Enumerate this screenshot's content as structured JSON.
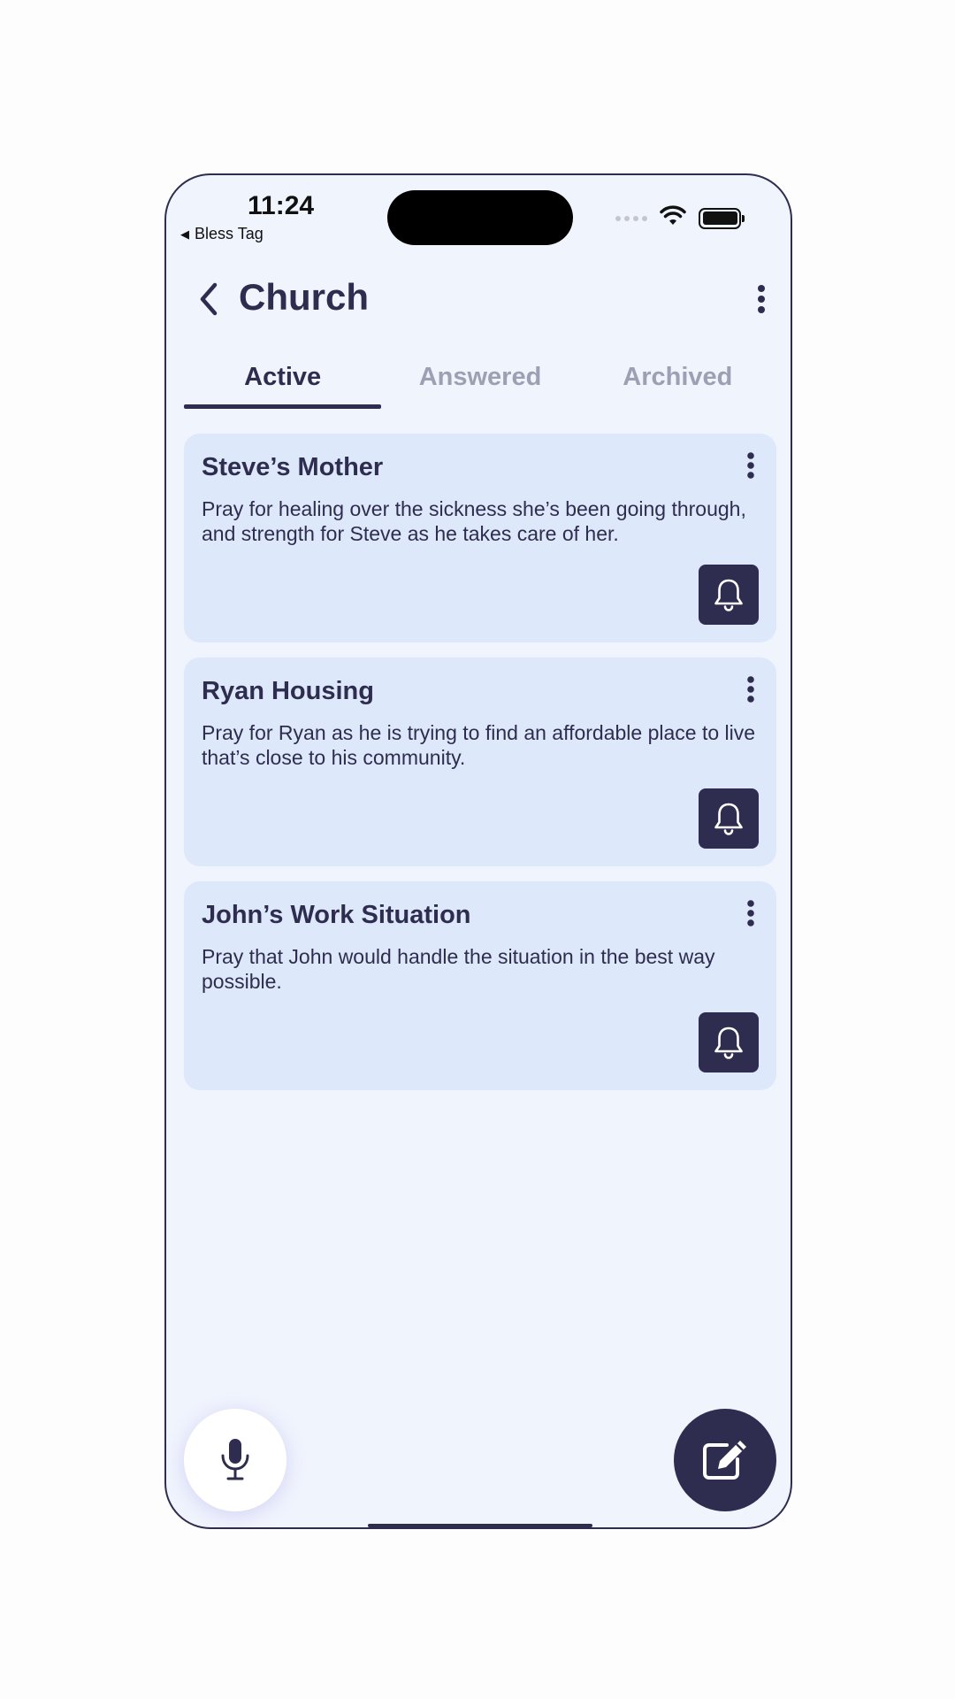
{
  "status_bar": {
    "time": "11:24",
    "back_app": "Bless Tag",
    "back_glyph": "◀"
  },
  "header": {
    "title": "Church"
  },
  "tabs": [
    {
      "label": "Active",
      "active": true
    },
    {
      "label": "Answered",
      "active": false
    },
    {
      "label": "Archived",
      "active": false
    }
  ],
  "prayers": [
    {
      "title": "Steve’s Mother",
      "text": "Pray for healing over the sickness she’s been going through, and strength for Steve as he takes care of her."
    },
    {
      "title": "Ryan Housing",
      "text": "Pray for Ryan as he is trying to find an affordable place to live that’s close to his community."
    },
    {
      "title": "John’s Work Situation",
      "text": "Pray that John would handle the situation in the best way possible."
    }
  ],
  "icons": {
    "back": "chevron-left-icon",
    "menu": "more-vertical-icon",
    "bell": "bell-icon",
    "mic": "microphone-icon",
    "compose": "edit-icon"
  },
  "colors": {
    "primary": "#2f2d4f",
    "background": "#f0f4fd",
    "card": "#dde8fb",
    "muted": "#9da0b2"
  }
}
